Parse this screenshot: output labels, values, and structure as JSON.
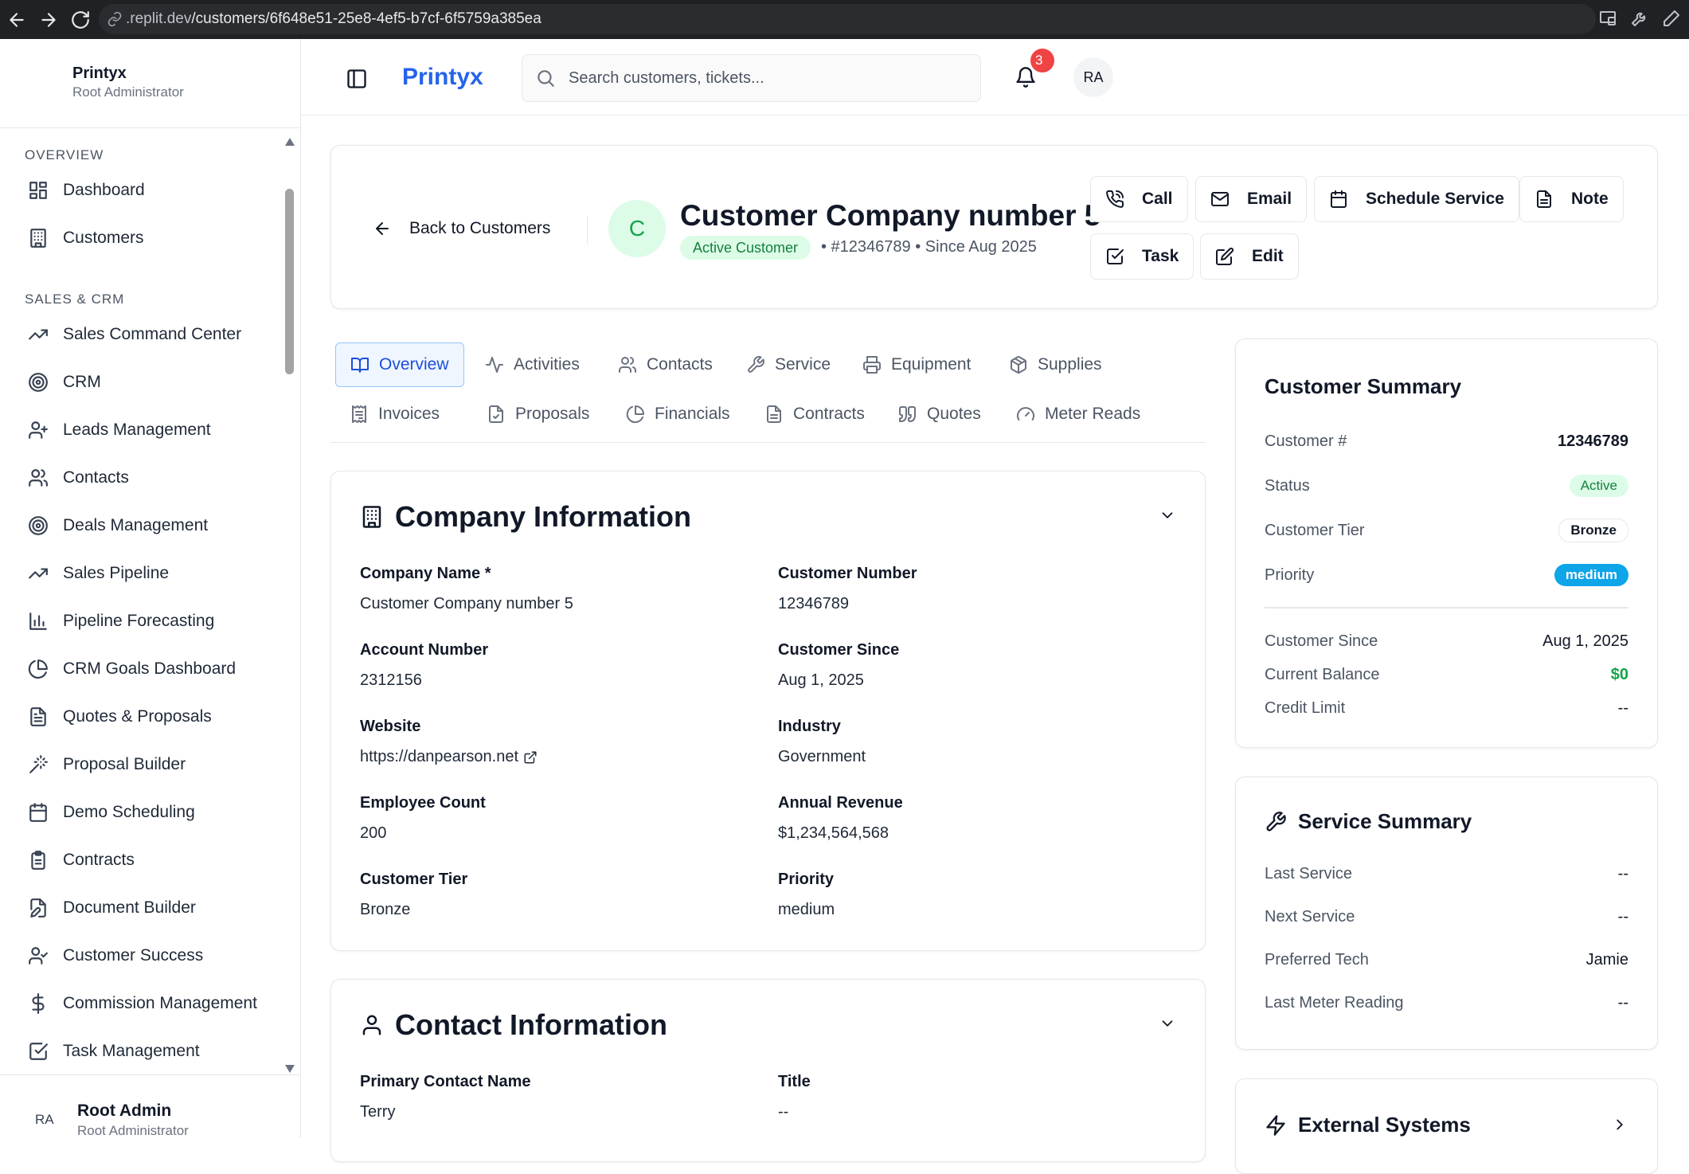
{
  "browser": {
    "url_host": ".replit.dev",
    "url_path": "/customers/6f648e51-25e8-4ef5-b7cf-6f5759a385ea"
  },
  "sidebar": {
    "brand_title": "Printyx",
    "brand_subtitle": "Root Administrator",
    "sections": [
      {
        "title": "OVERVIEW"
      },
      {
        "title": "SALES & CRM"
      }
    ],
    "items": [
      {
        "label": "Dashboard",
        "icon": "dashboard-icon"
      },
      {
        "label": "Customers",
        "icon": "building-icon"
      },
      {
        "label": "Sales Command Center",
        "icon": "trending-up-icon"
      },
      {
        "label": "CRM",
        "icon": "target-icon"
      },
      {
        "label": "Leads Management",
        "icon": "user-plus-icon"
      },
      {
        "label": "Contacts",
        "icon": "users-icon"
      },
      {
        "label": "Deals Management",
        "icon": "target-icon"
      },
      {
        "label": "Sales Pipeline",
        "icon": "trending-up-icon"
      },
      {
        "label": "Pipeline Forecasting",
        "icon": "bar-chart-icon"
      },
      {
        "label": "CRM Goals Dashboard",
        "icon": "pie-chart-icon"
      },
      {
        "label": "Quotes & Proposals",
        "icon": "file-text-icon"
      },
      {
        "label": "Proposal Builder",
        "icon": "wand-icon"
      },
      {
        "label": "Demo Scheduling",
        "icon": "calendar-icon"
      },
      {
        "label": "Contracts",
        "icon": "clipboard-icon"
      },
      {
        "label": "Document Builder",
        "icon": "file-edit-icon"
      },
      {
        "label": "Customer Success",
        "icon": "user-check-icon"
      },
      {
        "label": "Commission Management",
        "icon": "dollar-icon"
      },
      {
        "label": "Task Management",
        "icon": "check-square-icon"
      }
    ],
    "user": {
      "initials": "RA",
      "name": "Root Admin",
      "role": "Root Administrator"
    }
  },
  "topbar": {
    "logo": "Printyx",
    "search_placeholder": "Search customers, tickets...",
    "notification_count": "3",
    "avatar_initials": "RA"
  },
  "header": {
    "back_label": "Back to Customers",
    "avatar_letter": "C",
    "customer_name": "Customer Company number 5",
    "status_chip": "Active Customer",
    "meta": "•  #12346789  •  Since Aug 2025",
    "actions": {
      "call": "Call",
      "email": "Email",
      "schedule": "Schedule Service",
      "note": "Note",
      "task": "Task",
      "edit": "Edit"
    }
  },
  "tabs": [
    {
      "label": "Overview",
      "icon": "book-icon"
    },
    {
      "label": "Activities",
      "icon": "activity-icon"
    },
    {
      "label": "Contacts",
      "icon": "users-icon"
    },
    {
      "label": "Service",
      "icon": "wrench-icon"
    },
    {
      "label": "Equipment",
      "icon": "printer-icon"
    },
    {
      "label": "Supplies",
      "icon": "package-icon"
    },
    {
      "label": "Invoices",
      "icon": "receipt-icon"
    },
    {
      "label": "Proposals",
      "icon": "file-check-icon"
    },
    {
      "label": "Financials",
      "icon": "pie-chart-icon"
    },
    {
      "label": "Contracts",
      "icon": "file-text-icon"
    },
    {
      "label": "Quotes",
      "icon": "quote-icon"
    },
    {
      "label": "Meter Reads",
      "icon": "gauge-icon"
    }
  ],
  "company": {
    "title": "Company Information",
    "fields": [
      {
        "label": "Company Name *",
        "value": "Customer Company number 5"
      },
      {
        "label": "Customer Number",
        "value": "12346789"
      },
      {
        "label": "Account Number",
        "value": "2312156"
      },
      {
        "label": "Customer Since",
        "value": "Aug 1, 2025"
      },
      {
        "label": "Website",
        "value": "https://danpearson.net"
      },
      {
        "label": "Industry",
        "value": "Government"
      },
      {
        "label": "Employee Count",
        "value": "200"
      },
      {
        "label": "Annual Revenue",
        "value": "$1,234,564,568"
      },
      {
        "label": "Customer Tier",
        "value": "Bronze"
      },
      {
        "label": "Priority",
        "value": "medium"
      }
    ]
  },
  "contact": {
    "title": "Contact Information",
    "fields": [
      {
        "label": "Primary Contact Name",
        "value": "Terry"
      },
      {
        "label": "Title",
        "value": "--"
      }
    ]
  },
  "summary": {
    "title": "Customer Summary",
    "rows": [
      {
        "key": "Customer #",
        "value": "12346789"
      },
      {
        "key": "Status",
        "value": "Active"
      },
      {
        "key": "Customer Tier",
        "value": "Bronze"
      },
      {
        "key": "Priority",
        "value": "medium"
      },
      {
        "key": "Customer Since",
        "value": "Aug 1, 2025"
      },
      {
        "key": "Current Balance",
        "value": "$0"
      },
      {
        "key": "Credit Limit",
        "value": "--"
      }
    ]
  },
  "service": {
    "title": "Service Summary",
    "rows": [
      {
        "key": "Last Service",
        "value": "--"
      },
      {
        "key": "Next Service",
        "value": "--"
      },
      {
        "key": "Preferred Tech",
        "value": "Jamie"
      },
      {
        "key": "Last Meter Reading",
        "value": "--"
      }
    ]
  },
  "external": {
    "title": "External Systems"
  },
  "colors": {
    "accent": "#2563eb",
    "success": "#16a34a",
    "danger": "#ef4444",
    "info": "#0ea5e9"
  }
}
